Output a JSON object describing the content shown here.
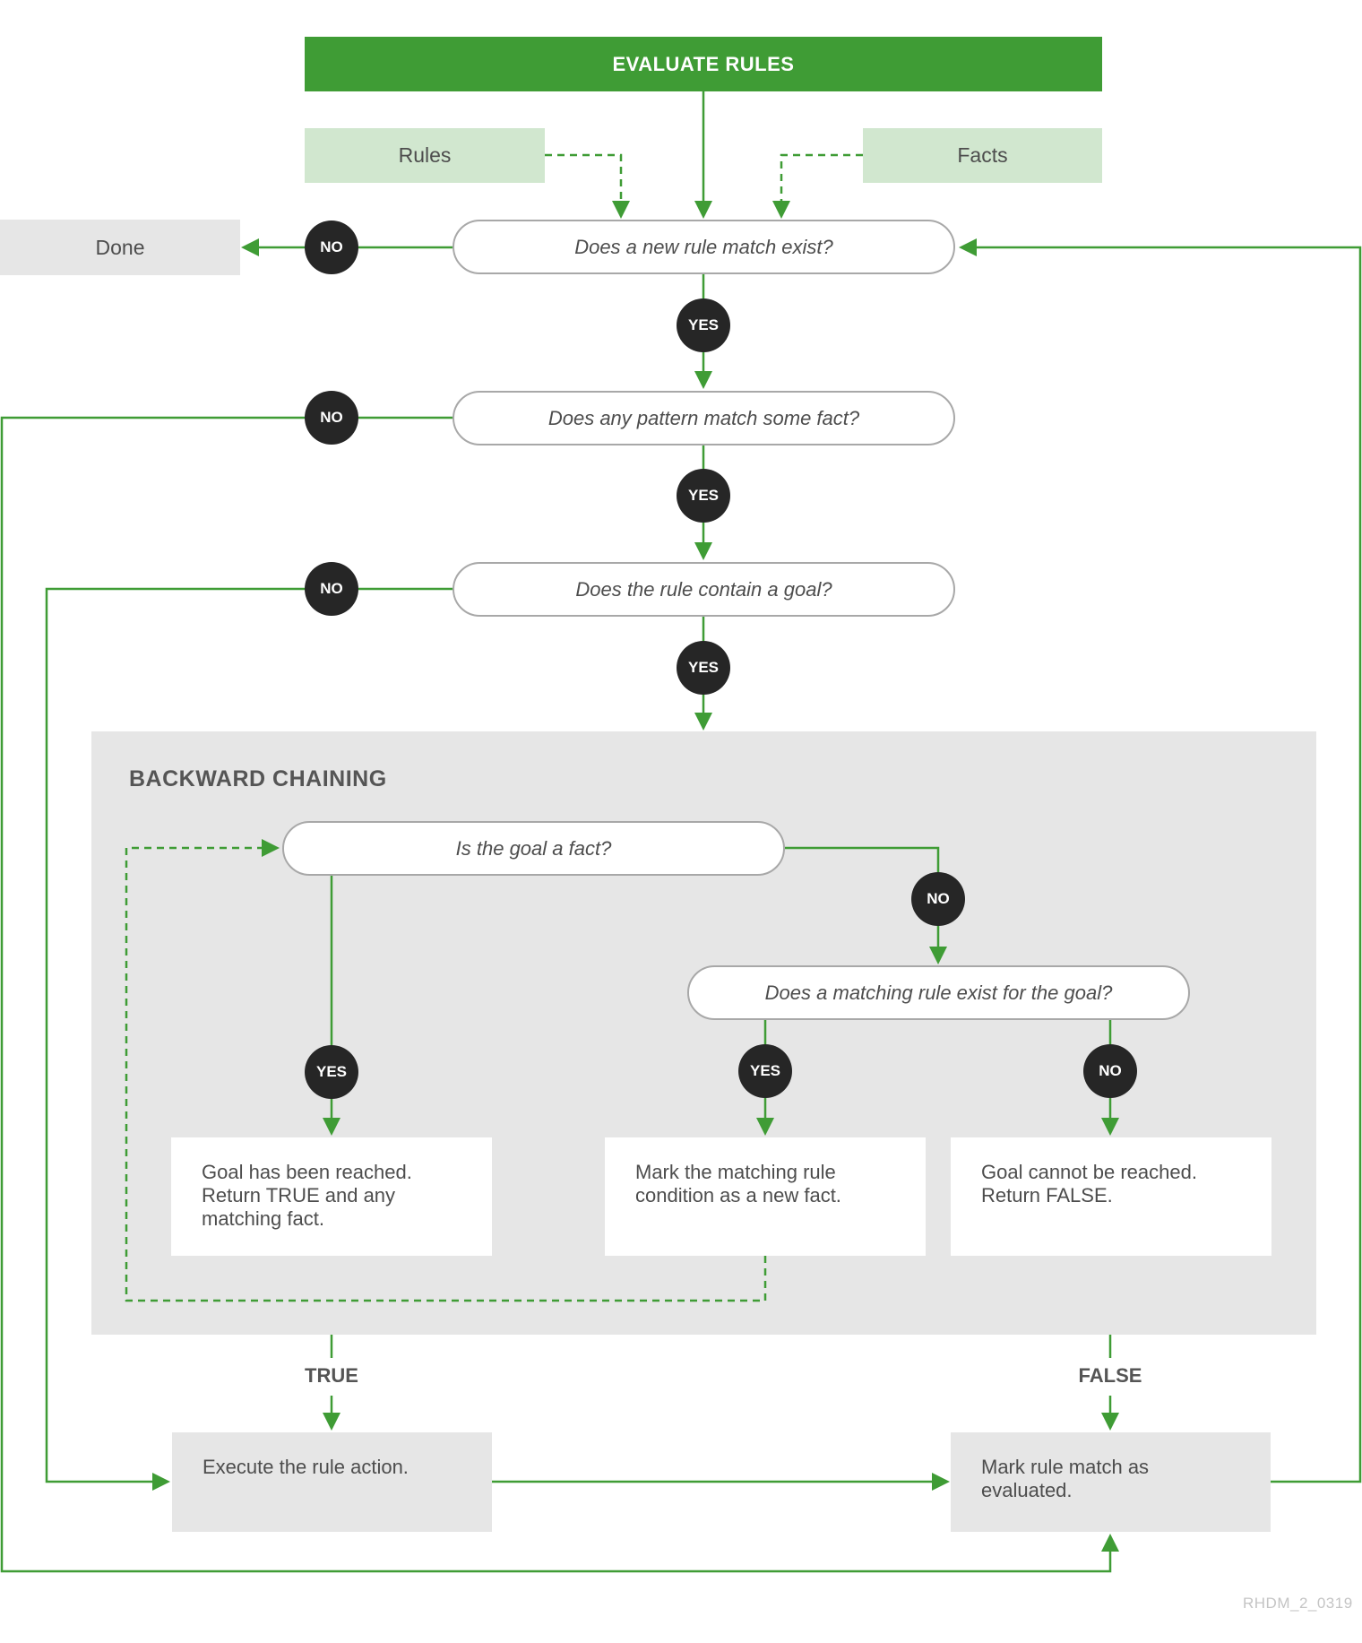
{
  "header": {
    "title": "EVALUATE RULES"
  },
  "inputs": {
    "rules": "Rules",
    "facts": "Facts"
  },
  "terminal": {
    "done": "Done"
  },
  "decisions": {
    "new_rule_match": "Does a new rule match exist?",
    "pattern_match": "Does any pattern match some fact?",
    "contains_goal": "Does the rule contain a goal?",
    "goal_is_fact": "Is the goal a fact?",
    "matching_rule_exists": "Does a matching rule exist for the goal?"
  },
  "badges": {
    "yes": "YES",
    "no": "NO"
  },
  "backward_chaining": {
    "title": "BACKWARD CHAINING",
    "results": {
      "goal_reached": "Goal has been reached. Return TRUE and any matching fact.",
      "mark_condition": "Mark the matching rule condition as a new fact.",
      "goal_unreachable": "Goal cannot be reached. Return FALSE."
    }
  },
  "edge_labels": {
    "true": "TRUE",
    "false": "FALSE"
  },
  "actions": {
    "execute": "Execute the rule action.",
    "mark_evaluated": "Mark rule match as evaluated."
  },
  "footer": {
    "figure_id": "RHDM_2_0319"
  },
  "colors": {
    "accent": "#3f9c35",
    "input_fill": "#d1e7cf",
    "panel_fill": "#e6e6e6",
    "badge_fill": "#262626"
  }
}
